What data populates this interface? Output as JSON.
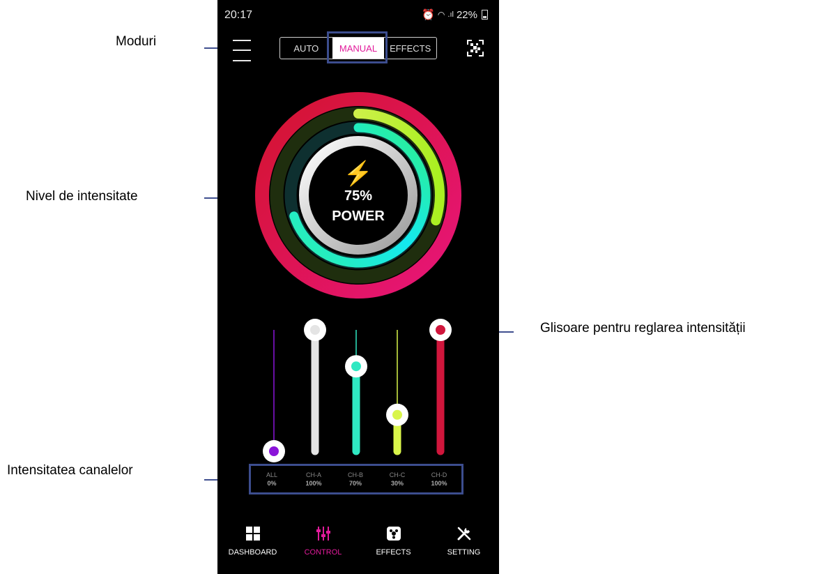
{
  "annotations": {
    "moduri": "Moduri",
    "nivel": "Nivel de intensitate",
    "glisoare": "Glisoare pentru reglarea intensității",
    "canale": "Intensitatea canalelor"
  },
  "status_bar": {
    "time": "20:17",
    "battery": "22%",
    "icons": [
      "alarm-icon",
      "wifi-icon",
      "signal-icon"
    ]
  },
  "mode_tabs": [
    {
      "label": "AUTO",
      "active": false
    },
    {
      "label": "MANUAL",
      "active": true
    },
    {
      "label": "EFFECTS",
      "active": false
    }
  ],
  "power": {
    "value": "75%",
    "label": "POWER",
    "icon": "lightning-icon"
  },
  "rings": [
    {
      "name": "red",
      "color": "#e0173f",
      "level": 1.0
    },
    {
      "name": "yellow",
      "color": "#c8f03a",
      "level": 0.3
    },
    {
      "name": "cyan",
      "color": "#1de5e0",
      "level": 0.7
    },
    {
      "name": "white",
      "color": "#e8e8e8",
      "level": 1.0
    }
  ],
  "channels": [
    {
      "name": "ALL",
      "value": "0%",
      "level": 0.0,
      "color": "#8a14d9"
    },
    {
      "name": "CH-A",
      "value": "100%",
      "level": 1.0,
      "color": "#e4e4e4"
    },
    {
      "name": "CH-B",
      "value": "70%",
      "level": 0.7,
      "color": "#2fe8c2"
    },
    {
      "name": "CH-C",
      "value": "30%",
      "level": 0.3,
      "color": "#d9f54a"
    },
    {
      "name": "CH-D",
      "value": "100%",
      "level": 1.0,
      "color": "#d0163c"
    }
  ],
  "bottom_nav": [
    {
      "label": "DASHBOARD",
      "icon": "dashboard-icon",
      "active": false
    },
    {
      "label": "CONTROL",
      "icon": "sliders-icon",
      "active": true
    },
    {
      "label": "EFFECTS",
      "icon": "effects-icon",
      "active": false
    },
    {
      "label": "SETTING",
      "icon": "tools-icon",
      "active": false
    }
  ],
  "colors": {
    "accent": "#e21b9b",
    "annotation_line": "#3f4f8f"
  }
}
